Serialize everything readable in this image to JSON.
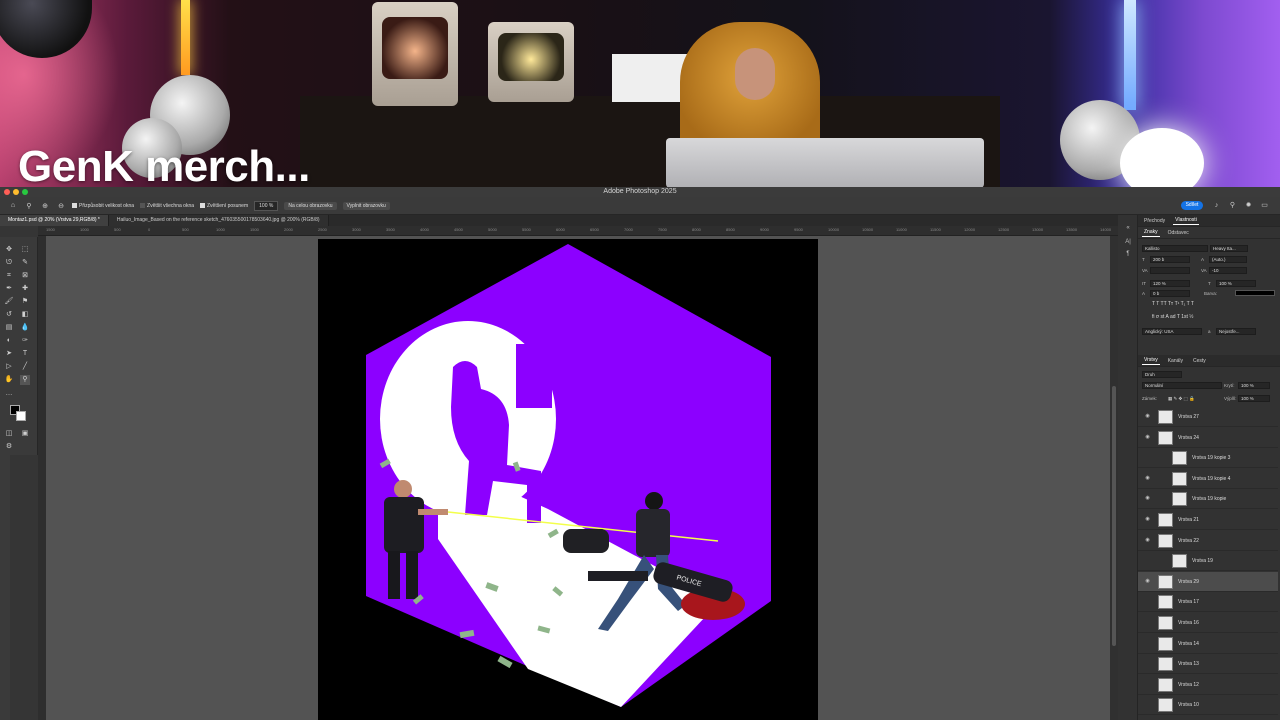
{
  "overlay": {
    "title": "GenK merch..."
  },
  "photoshop": {
    "app_title": "Adobe Photoshop 2025",
    "share_label": "Sdílet",
    "options": {
      "resize_windows": "Přizpůsobit velikost okna",
      "zoom_all": "Zvětšit všechna okna",
      "scrubby_zoom": "Zvětšení posunem",
      "zoom_value": "100 %",
      "fit_screen": "Na celou obrazovku",
      "fill_screen": "Vyplnit obrazovku"
    },
    "tabs": [
      {
        "label": "Montaz1.psd @ 20% (Vrstva 29,RGB/8) *"
      },
      {
        "label": "Hailuo_Image_Based on the reference sketch_476035500178503640.jpg @ 200% (RGB/8)"
      }
    ],
    "ruler_labels": [
      "1500",
      "1000",
      "500",
      "0",
      "500",
      "1000",
      "1500",
      "2000",
      "2500",
      "3000",
      "3500",
      "4000",
      "4500",
      "5000",
      "5500",
      "6000",
      "6500",
      "7000",
      "7500",
      "8000",
      "8500",
      "9000",
      "9500",
      "10000",
      "10500",
      "11000",
      "11500",
      "12000",
      "12500",
      "13000",
      "13500",
      "14000"
    ],
    "panel": {
      "top_tabs": [
        "Přechody",
        "Vlastnosti"
      ],
      "char_tabs": [
        "Znaky",
        "Odstavec"
      ],
      "font_family": "Kallisto",
      "font_style": "Heavy Ita...",
      "font_size": "200 b",
      "leading": "(Auto.)",
      "tracking": "-10",
      "vscale": "120 %",
      "hscale": "100 %",
      "baseline": "0 b",
      "color_label": "Barva:",
      "language": "Anglický: USA",
      "aa_label": "Nejostře...",
      "aa_prefix": "a",
      "typo_buttons": "T  T  TT  Tт  T¹  T₁  T  T",
      "opentype_buttons": "fi  ơ  st  A  ad  T  1st  ½"
    },
    "layers_panel": {
      "tabs": [
        "Vrstvy",
        "Kanály",
        "Cesty"
      ],
      "filter": "Druh",
      "blend_mode": "Normální",
      "opacity_label": "Krytí:",
      "opacity": "100 %",
      "lock_label": "Zámek:",
      "fill_label": "Výplň:",
      "fill": "100 %",
      "layers": [
        {
          "name": "Vrstva 27",
          "visible": true
        },
        {
          "name": "Vrstva 24",
          "visible": true
        },
        {
          "name": "Vrstva 19 kopie 3",
          "visible": false
        },
        {
          "name": "Vrstva 19 kopie 4",
          "visible": true
        },
        {
          "name": "Vrstva 19 kopie",
          "visible": true
        },
        {
          "name": "Vrstva 21",
          "visible": true
        },
        {
          "name": "Vrstva 22",
          "visible": true
        },
        {
          "name": "Vrstva 19",
          "visible": false
        },
        {
          "name": "Vrstva 29",
          "visible": true,
          "selected": true
        },
        {
          "name": "Vrstva 17",
          "visible": false
        },
        {
          "name": "Vrstva 16",
          "visible": false
        },
        {
          "name": "Vrstva 14",
          "visible": false
        },
        {
          "name": "Vrstva 13",
          "visible": false
        },
        {
          "name": "Vrstva 12",
          "visible": false
        },
        {
          "name": "Vrstva 10",
          "visible": false
        }
      ]
    },
    "canvas_art": {
      "accent": "#8c00ff",
      "bg": "#000000",
      "badge_text": "POLICE"
    }
  }
}
